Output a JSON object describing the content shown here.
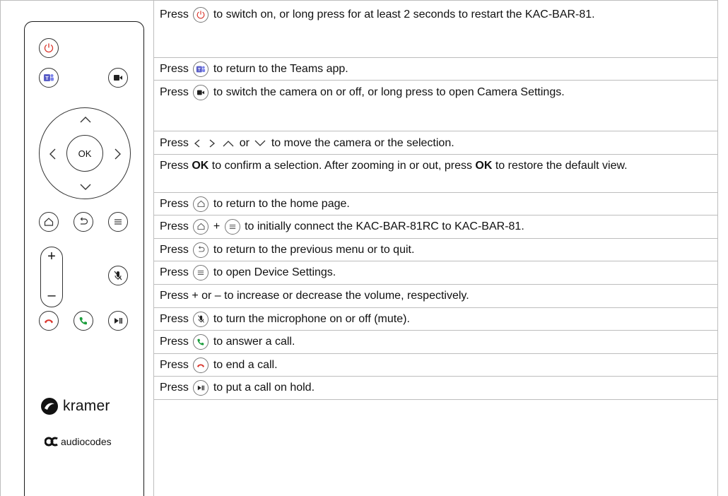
{
  "remote": {
    "ok_label": "OK",
    "volume_plus": "+",
    "volume_minus": "–",
    "brand_primary": "kramer",
    "brand_secondary": "audiocodes",
    "colors": {
      "power": "#d9342b",
      "teams": "#5b5fc7",
      "answer": "#1b9d3c",
      "end": "#d9342b"
    }
  },
  "rows": {
    "power": {
      "pre": "Press",
      "post": "to switch on, or long press for at least 2 seconds to restart the KAC-BAR-81."
    },
    "teams": {
      "pre": "Press",
      "post": "to return to the Teams app."
    },
    "camera": {
      "pre": "Press",
      "post": "to switch the camera on or off, or long press to open Camera Settings."
    },
    "arrows": {
      "pre": "Press",
      "mid": "or",
      "post": "to move the camera or the selection."
    },
    "ok": {
      "p1": "Press ",
      "b1": "OK",
      "p2": " to confirm a selection. After zooming in or out, press ",
      "b2": "OK",
      "p3": " to restore the default view."
    },
    "home": {
      "pre": "Press",
      "post": "to return to the home page."
    },
    "pair": {
      "pre": "Press",
      "plus": "+",
      "post": "to initially connect the KAC-BAR-81RC to KAC-BAR-81."
    },
    "back": {
      "pre": "Press",
      "post": "to return to the previous menu or to quit."
    },
    "menu": {
      "pre": "Press",
      "post": "to open Device Settings."
    },
    "volume": {
      "text": "Press + or – to increase or decrease the volume, respectively."
    },
    "mute": {
      "pre": "Press",
      "post": "to turn the microphone on or off (mute)."
    },
    "answer": {
      "pre": "Press",
      "post": "to answer a call."
    },
    "end": {
      "pre": "Press",
      "post": "to end a call."
    },
    "hold": {
      "pre": "Press",
      "post": "to put a call on hold."
    }
  }
}
